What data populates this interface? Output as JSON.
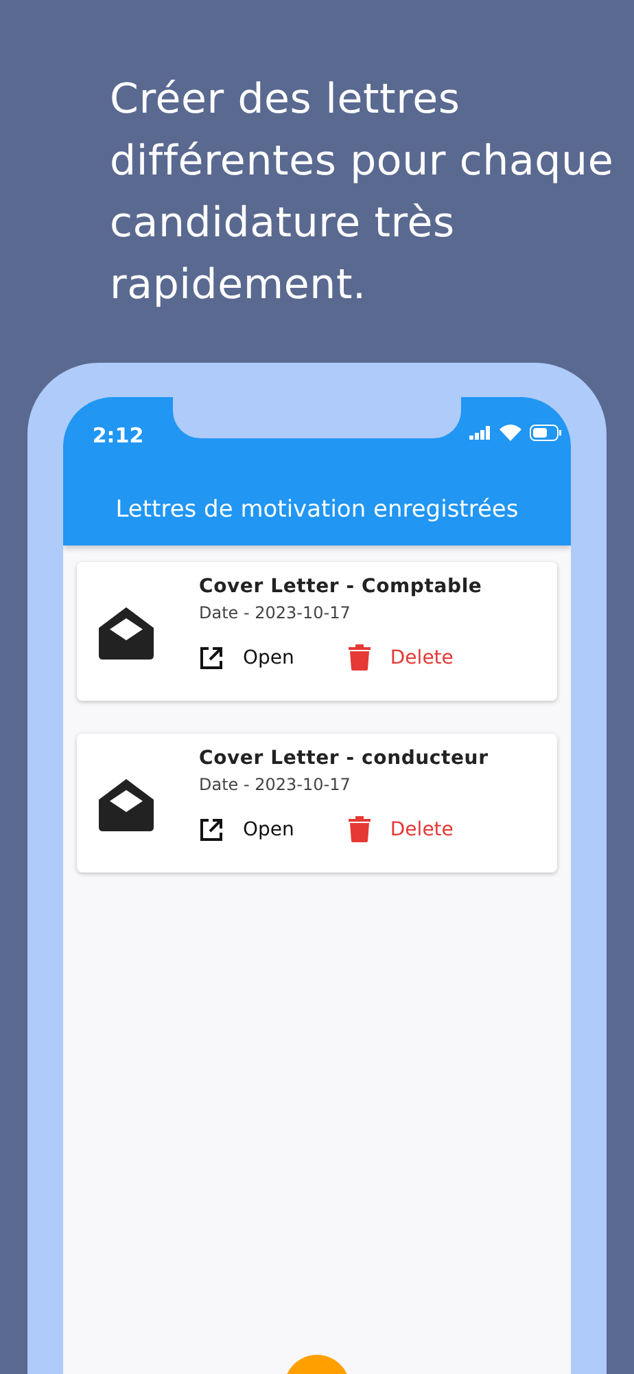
{
  "headline": "Créer des lettres différentes pour chaque candidature très rapidement.",
  "status_bar": {
    "time": "2:12"
  },
  "app_bar": {
    "title": "Lettres de motivation enregistrées"
  },
  "letters": [
    {
      "title": "Cover Letter - Comptable",
      "date": "Date - 2023-10-17",
      "actions": [
        {
          "kind": "open",
          "label": "Open"
        },
        {
          "kind": "delete",
          "label": "Delete"
        }
      ]
    },
    {
      "title": "Cover Letter - conducteur",
      "date": "Date - 2023-10-17",
      "actions": [
        {
          "kind": "open",
          "label": "Open"
        },
        {
          "kind": "delete",
          "label": "Delete"
        }
      ]
    }
  ]
}
